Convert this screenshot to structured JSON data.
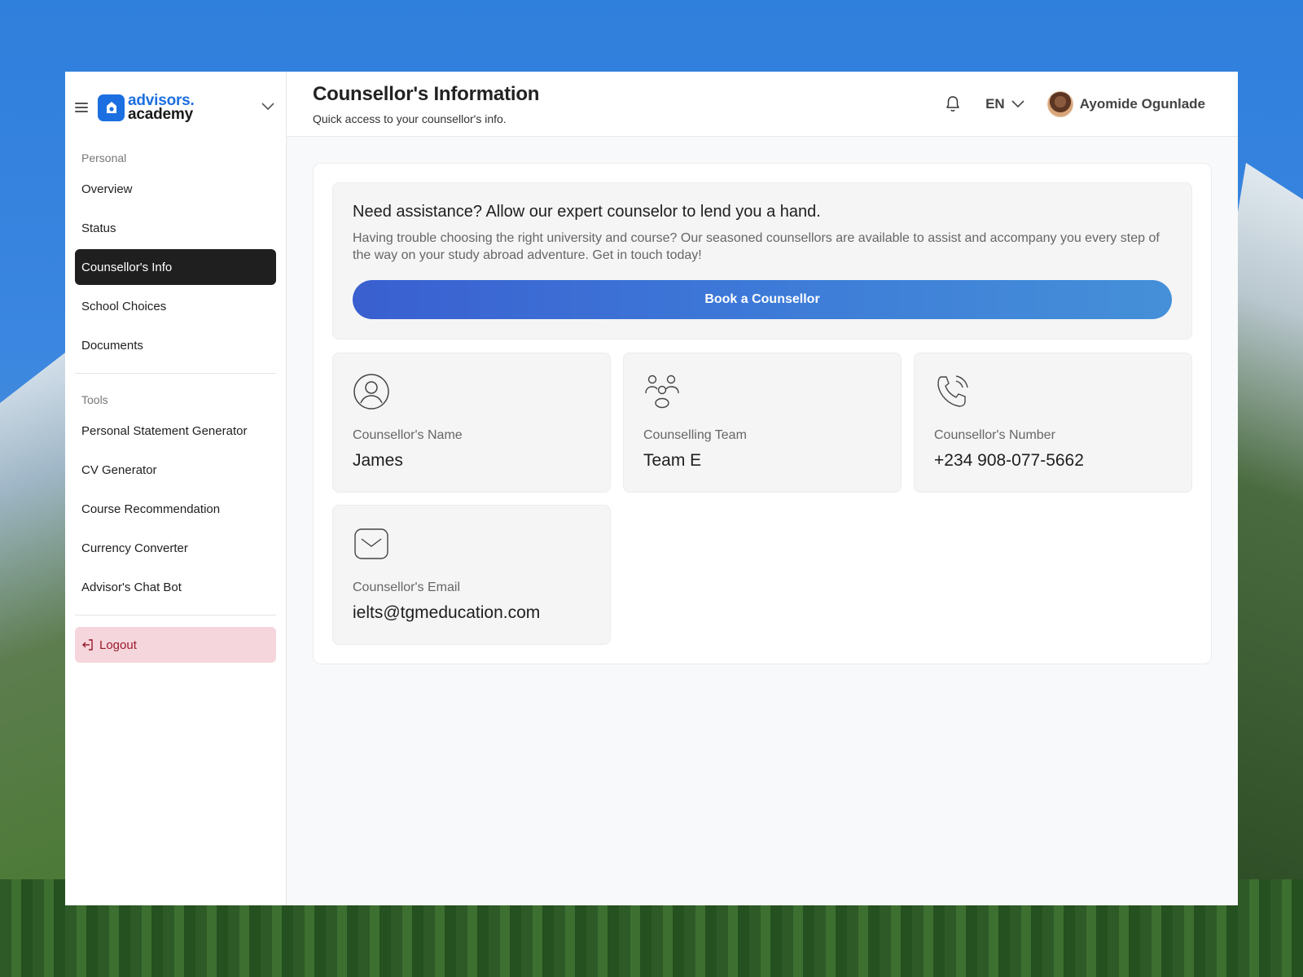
{
  "brand": {
    "line1": "advisors.",
    "line2": "academy"
  },
  "sidebar": {
    "personal_label": "Personal",
    "personal_items": [
      {
        "label": "Overview",
        "active": false
      },
      {
        "label": "Status",
        "active": false
      },
      {
        "label": "Counsellor's Info",
        "active": true
      },
      {
        "label": "School Choices",
        "active": false
      },
      {
        "label": "Documents",
        "active": false
      }
    ],
    "tools_label": "Tools",
    "tools_items": [
      {
        "label": "Personal Statement Generator"
      },
      {
        "label": "CV Generator"
      },
      {
        "label": "Course Recommendation"
      },
      {
        "label": "Currency Converter"
      },
      {
        "label": "Advisor's Chat Bot"
      }
    ],
    "logout_label": "Logout"
  },
  "header": {
    "title": "Counsellor's Information",
    "subtitle": "Quick access to your counsellor's info.",
    "language": "EN",
    "user_name": "Ayomide Ogunlade"
  },
  "assist": {
    "heading": "Need assistance? Allow our expert counselor to lend you a hand.",
    "body": "Having trouble choosing the right university and course? Our seasoned counsellors are available to assist and accompany you every step of the way on your study abroad adventure. Get in touch today!",
    "button_label": "Book a Counsellor"
  },
  "cards": [
    {
      "icon": "user-circle-icon",
      "label": "Counsellor's Name",
      "value": "James"
    },
    {
      "icon": "team-icon",
      "label": "Counselling Team",
      "value": "Team E"
    },
    {
      "icon": "phone-icon",
      "label": "Counsellor's Number",
      "value": "+234 908-077-5662"
    },
    {
      "icon": "mail-icon",
      "label": "Counsellor's Email",
      "value": "ielts@tgmeducation.com"
    }
  ],
  "colors": {
    "brand": "#1c6fe0",
    "active_nav": "#1f1f1f",
    "logout_bg": "#f6d6dd",
    "logout_text": "#9a1b2a",
    "button_gradient_start": "#3a5fd0",
    "button_gradient_end": "#4590d8"
  }
}
